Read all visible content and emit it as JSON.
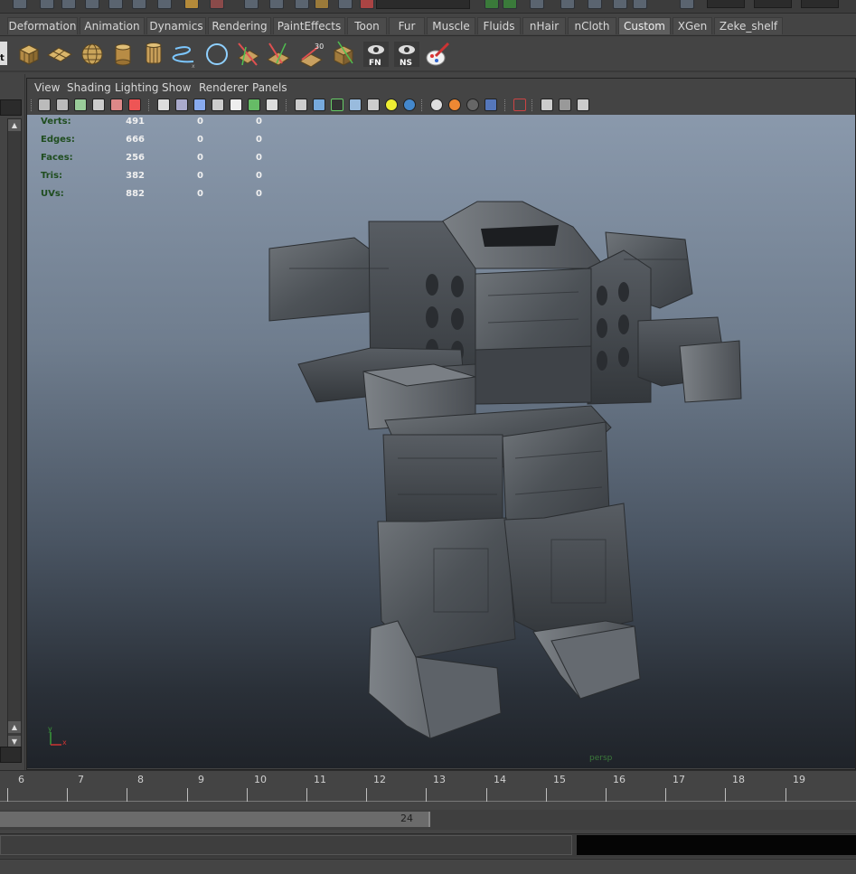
{
  "shelf": {
    "tabs": [
      {
        "label": "Deformation",
        "active": false
      },
      {
        "label": "Animation",
        "active": false
      },
      {
        "label": "Dynamics",
        "active": false
      },
      {
        "label": "Rendering",
        "active": false
      },
      {
        "label": "PaintEffects",
        "active": false
      },
      {
        "label": "Toon",
        "active": false
      },
      {
        "label": "Fur",
        "active": false
      },
      {
        "label": "Muscle",
        "active": false
      },
      {
        "label": "Fluids",
        "active": false
      },
      {
        "label": "nHair",
        "active": false
      },
      {
        "label": "nCloth",
        "active": false
      },
      {
        "label": "Custom",
        "active": true
      },
      {
        "label": "XGen",
        "active": false
      },
      {
        "label": "Zeke_shelf",
        "active": false
      }
    ],
    "icons": [
      {
        "name": "cube-crate-icon"
      },
      {
        "name": "plane-crate-icon"
      },
      {
        "name": "sphere-crate-icon"
      },
      {
        "name": "cylinder-icon"
      },
      {
        "name": "barrel-icon"
      },
      {
        "name": "curve-tool-icon"
      },
      {
        "name": "circle-icon"
      },
      {
        "name": "split-edge-icon"
      },
      {
        "name": "multi-cut-icon"
      },
      {
        "name": "bevel-30-icon",
        "text": "30"
      },
      {
        "name": "uv-crate-icon"
      },
      {
        "name": "face-normals-icon",
        "text": "FN"
      },
      {
        "name": "normal-size-icon",
        "text": "NS"
      },
      {
        "name": "paint-brush-icon"
      }
    ],
    "left_edge_label": "t"
  },
  "viewport": {
    "menu": [
      "View",
      "Shading",
      "Lighting",
      "Show",
      "Renderer",
      "Panels"
    ],
    "hud": {
      "rows": [
        {
          "label": "Verts:",
          "object": "491",
          "selected": "0",
          "component": "0"
        },
        {
          "label": "Edges:",
          "object": "666",
          "selected": "0",
          "component": "0"
        },
        {
          "label": "Faces:",
          "object": "256",
          "selected": "0",
          "component": "0"
        },
        {
          "label": "Tris:",
          "object": "382",
          "selected": "0",
          "component": "0"
        },
        {
          "label": "UVs:",
          "object": "882",
          "selected": "0",
          "component": "0"
        }
      ]
    },
    "camera_name": "persp",
    "axis": {
      "y": "y",
      "x": "x"
    },
    "colors": {
      "hud_label": "#1f4d1f",
      "camera_label": "#3b7a3b",
      "background_top": "#8a99ac",
      "background_bottom": "#1f2329"
    }
  },
  "time_slider": {
    "ticks": [
      "6",
      "7",
      "8",
      "9",
      "10",
      "11",
      "12",
      "13",
      "14",
      "15",
      "16",
      "17",
      "18",
      "19"
    ]
  },
  "range_slider": {
    "end_value": "24"
  },
  "scroll": {
    "up": "▲",
    "down": "▼"
  }
}
